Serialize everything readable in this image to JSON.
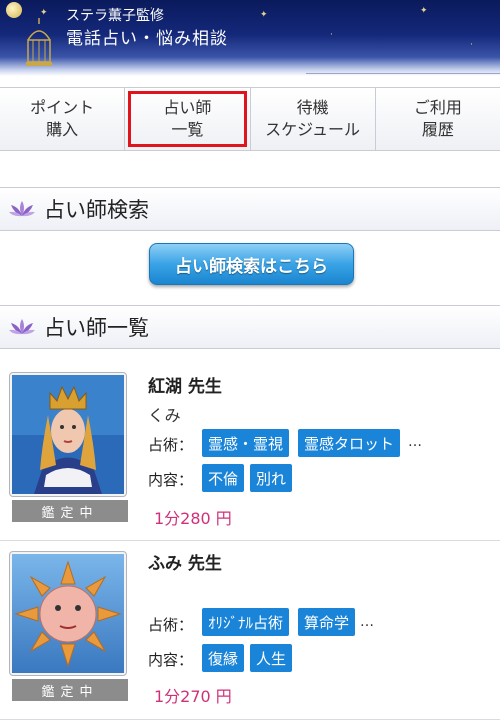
{
  "header": {
    "subtitle": "ステラ薫子監修",
    "title": "電話占い・悩み相談"
  },
  "nav": [
    {
      "line1": "ポイント",
      "line2": "購入"
    },
    {
      "line1": "占い師",
      "line2": "一覧"
    },
    {
      "line1": "待機",
      "line2": "スケジュール"
    },
    {
      "line1": "ご利用",
      "line2": "履歴"
    }
  ],
  "sections": {
    "search": "占い師検索",
    "list": "占い師一覧"
  },
  "search_button": "占い師検索はこちら",
  "row_labels": {
    "technique": "占術：",
    "content": "内容："
  },
  "fortune_tellers": [
    {
      "name": "紅湖 先生",
      "kana": "くみ",
      "status": "鑑定中",
      "techniques": [
        "霊感・霊視",
        "霊感タロット"
      ],
      "ellipsis": "…",
      "contents": [
        "不倫",
        "別れ"
      ],
      "price": "1分280 円"
    },
    {
      "name": "ふみ 先生",
      "kana": "",
      "status": "鑑定中",
      "techniques": [
        "ｵﾘｼﾞﾅﾙ占術",
        "算命学"
      ],
      "ellipsis": "…",
      "contents": [
        "復縁",
        "人生"
      ],
      "price": "1分270 円"
    }
  ],
  "colors": {
    "accent": "#1a85d8",
    "price": "#d0307a",
    "active_tab_border": "#e0141c",
    "header": "#14287a"
  }
}
